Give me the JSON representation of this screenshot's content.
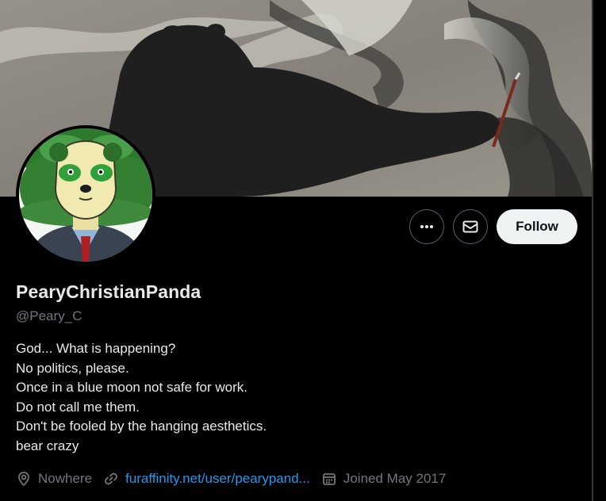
{
  "profile": {
    "display_name": "PearyChristianPanda",
    "handle": "@Peary_C",
    "bio_lines": [
      "God... What is happening?",
      "No politics, please.",
      "Once in a blue moon not safe for work.",
      "Do not call me them.",
      "Don't be fooled by the hanging aesthetics.",
      "bear crazy"
    ]
  },
  "actions": {
    "more_icon": "more-dots-icon",
    "message_icon": "envelope-icon",
    "follow_label": "Follow"
  },
  "meta": {
    "location_icon": "location-pin-icon",
    "location": "Nowhere",
    "link_icon": "link-icon",
    "website": "furaffinity.net/user/pearypand...",
    "joined_icon": "calendar-icon",
    "joined": "Joined May 2017"
  },
  "colors": {
    "background": "#000000",
    "text_primary": "#e7e9ea",
    "text_secondary": "#71767b",
    "link": "#1d9bf0",
    "follow_button_bg": "#eff3f4",
    "follow_button_text": "#0f1419",
    "outline_button_border": "#536471"
  }
}
